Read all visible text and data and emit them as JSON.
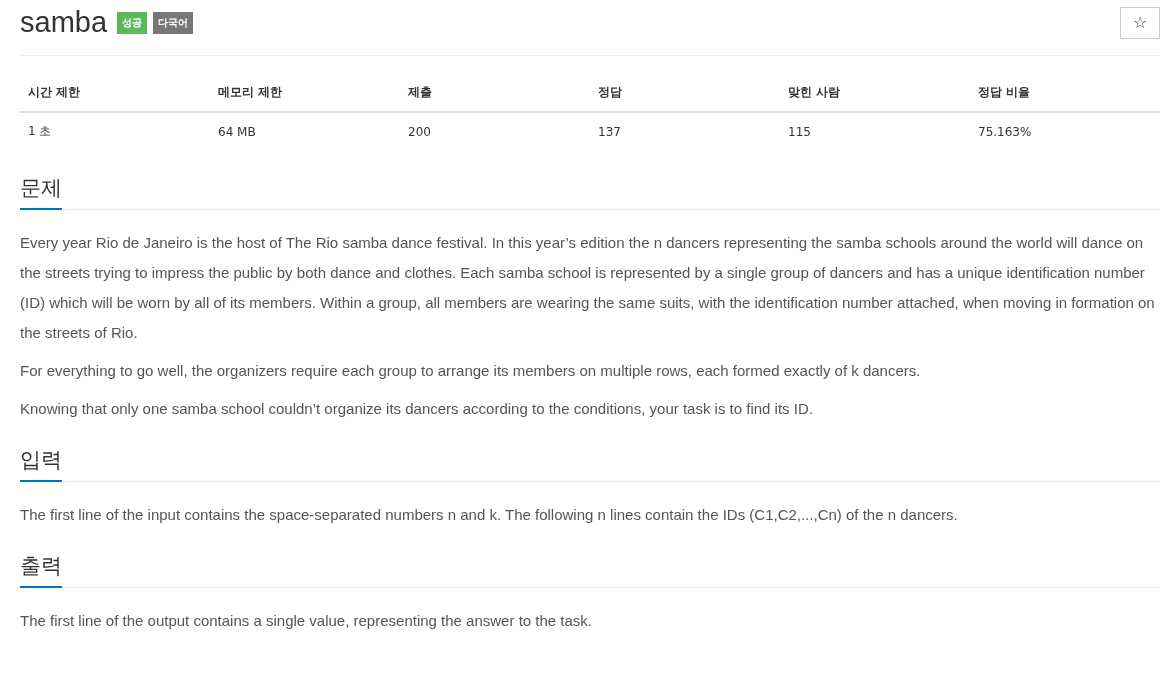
{
  "title": "samba",
  "badges": [
    {
      "label": "성공",
      "color": "#5cb85c"
    },
    {
      "label": "다국어",
      "color": "#777777"
    }
  ],
  "star_button": "☆",
  "stats": {
    "columns": [
      "시간 제한",
      "메모리 제한",
      "제출",
      "정답",
      "맞힌 사람",
      "정답 비율"
    ],
    "values": [
      "1 초",
      "64 MB",
      "200",
      "137",
      "115",
      "75.163%"
    ]
  },
  "sections": [
    {
      "heading": "문제",
      "paragraphs": [
        "Every year Rio de Janeiro is the host of The Rio samba dance festival. In this year’s edition the n dancers representing the samba schools around the world will dance on the streets trying to impress the public by both dance and clothes. Each samba school is represented by a single group of dancers and has a unique identification number (ID) which will be worn by all of its members. Within a group, all members are wearing the same suits, with the identification number attached, when moving in formation on the streets of Rio.",
        "For everything to go well, the organizers require each group to arrange its members on multiple rows, each formed exactly of k dancers.",
        "Knowing that only one samba school couldn’t organize its dancers according to the conditions, your task is to find its ID."
      ]
    },
    {
      "heading": "입력",
      "paragraphs": [
        "The first line of the input contains the space-separated numbers n and k. The following n lines contain the IDs (C1,C2,...,Cn) of the n dancers."
      ]
    },
    {
      "heading": "출력",
      "paragraphs": [
        "The first line of the output contains a single value, representing the answer to the task."
      ]
    }
  ]
}
